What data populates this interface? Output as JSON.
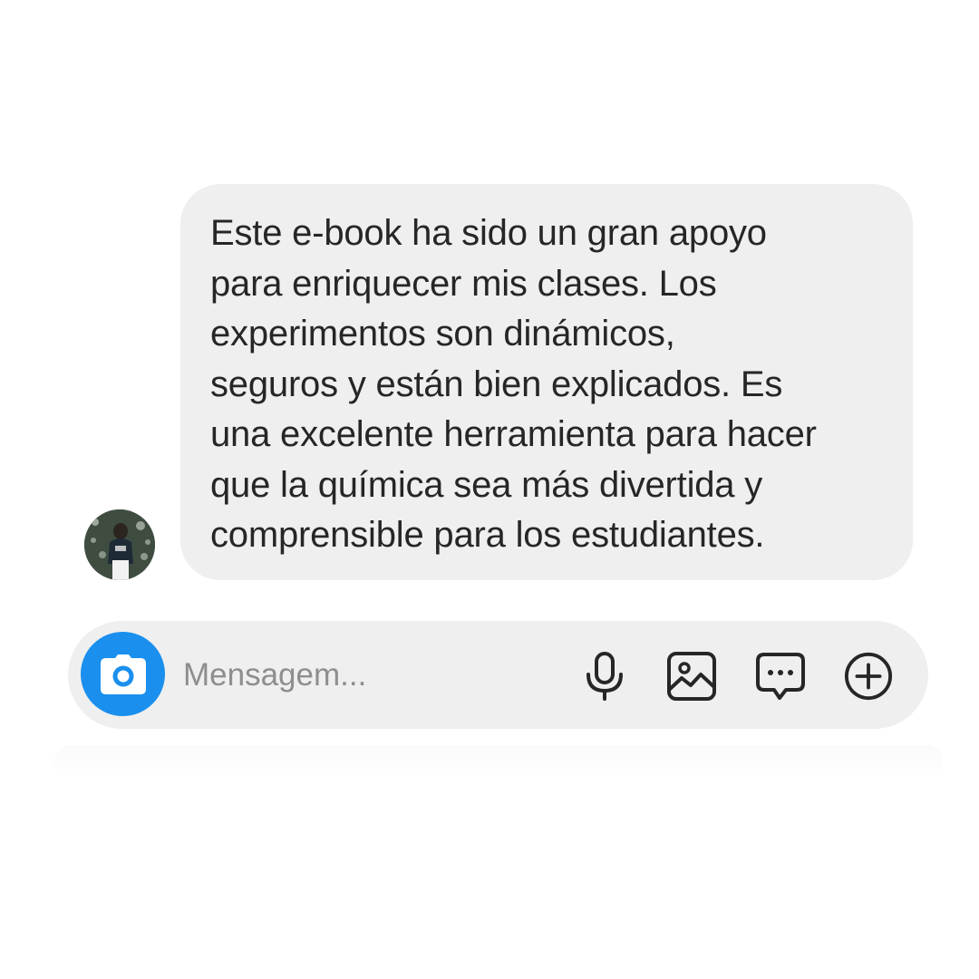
{
  "message": {
    "lines": [
      "Este e-book ha sido un gran apoyo",
      "para enriquecer mis clases. Los",
      "experimentos son dinámicos,",
      "seguros y están bien explicados. Es",
      "una excelente herramienta para hacer",
      "que la química sea más divertida y",
      "comprensible para los estudiantes."
    ]
  },
  "composer": {
    "placeholder": "Mensagem...",
    "value": ""
  },
  "icons": {
    "camera": "camera-icon",
    "microphone": "microphone-icon",
    "gallery": "image-icon",
    "sticker": "chat-bubble-icon",
    "more": "plus-circle-icon"
  },
  "colors": {
    "background": "#ffffff",
    "bubble": "#efefef",
    "composer": "#efefef",
    "camera_button": "#1a8fee",
    "text": "#262626",
    "placeholder": "#8e8e8e"
  }
}
